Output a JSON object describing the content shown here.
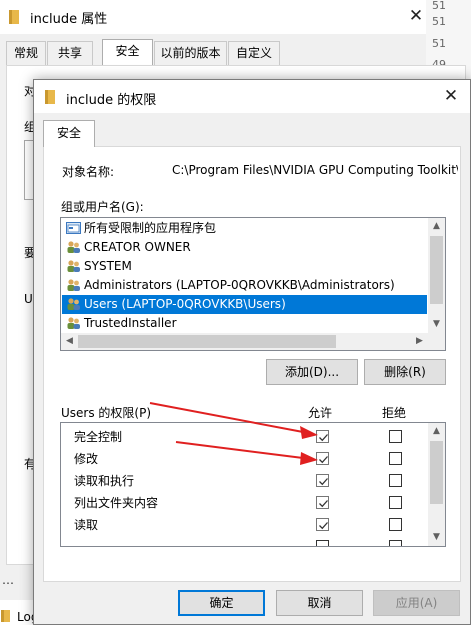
{
  "background_window": {
    "title": "include 属性",
    "close_symbol": "✕",
    "tabs": [
      "常规",
      "共享",
      "安全",
      "以前的版本",
      "自定义"
    ],
    "active_tab": "安全",
    "right_numbers": [
      "51",
      "51",
      "51",
      "49"
    ],
    "left_clipped": [
      "对",
      "组",
      "要",
      "U",
      "有"
    ],
    "bottom_dots": "…",
    "bottom_text": "Log"
  },
  "dialog": {
    "title": "include 的权限",
    "close_symbol": "✕",
    "tab": "安全",
    "object_name_label": "对象名称:",
    "object_name_value": "C:\\Program Files\\NVIDIA GPU Computing Toolkit\\",
    "group_label": "组或用户名(G):",
    "groups": [
      {
        "icon": "package-icon",
        "name": "所有受限制的应用程序包"
      },
      {
        "icon": "users-group-icon",
        "name": "CREATOR OWNER"
      },
      {
        "icon": "users-group-icon",
        "name": "SYSTEM"
      },
      {
        "icon": "users-group-icon",
        "name": "Administrators (LAPTOP-0QROVKKB\\Administrators)"
      },
      {
        "icon": "users-group-icon",
        "name": "Users (LAPTOP-0QROVKKB\\Users)",
        "selected": true
      },
      {
        "icon": "users-group-icon",
        "name": "TrustedInstaller"
      }
    ],
    "add_button": "添加(D)...",
    "remove_button": "删除(R)",
    "permissions_label": "Users 的权限(P)",
    "allow_header": "允许",
    "deny_header": "拒绝",
    "permissions": [
      {
        "name": "完全控制",
        "allow": true,
        "deny": false
      },
      {
        "name": "修改",
        "allow": true,
        "deny": false
      },
      {
        "name": "读取和执行",
        "allow": true,
        "deny": false
      },
      {
        "name": "列出文件夹内容",
        "allow": true,
        "deny": false
      },
      {
        "name": "读取",
        "allow": true,
        "deny": false
      }
    ],
    "ok_button": "确定",
    "cancel_button": "取消",
    "apply_button": "应用(A)"
  },
  "colors": {
    "selection": "#0078d7",
    "annotation_arrow": "#e02020",
    "folder_icon": "#e8b84a"
  }
}
